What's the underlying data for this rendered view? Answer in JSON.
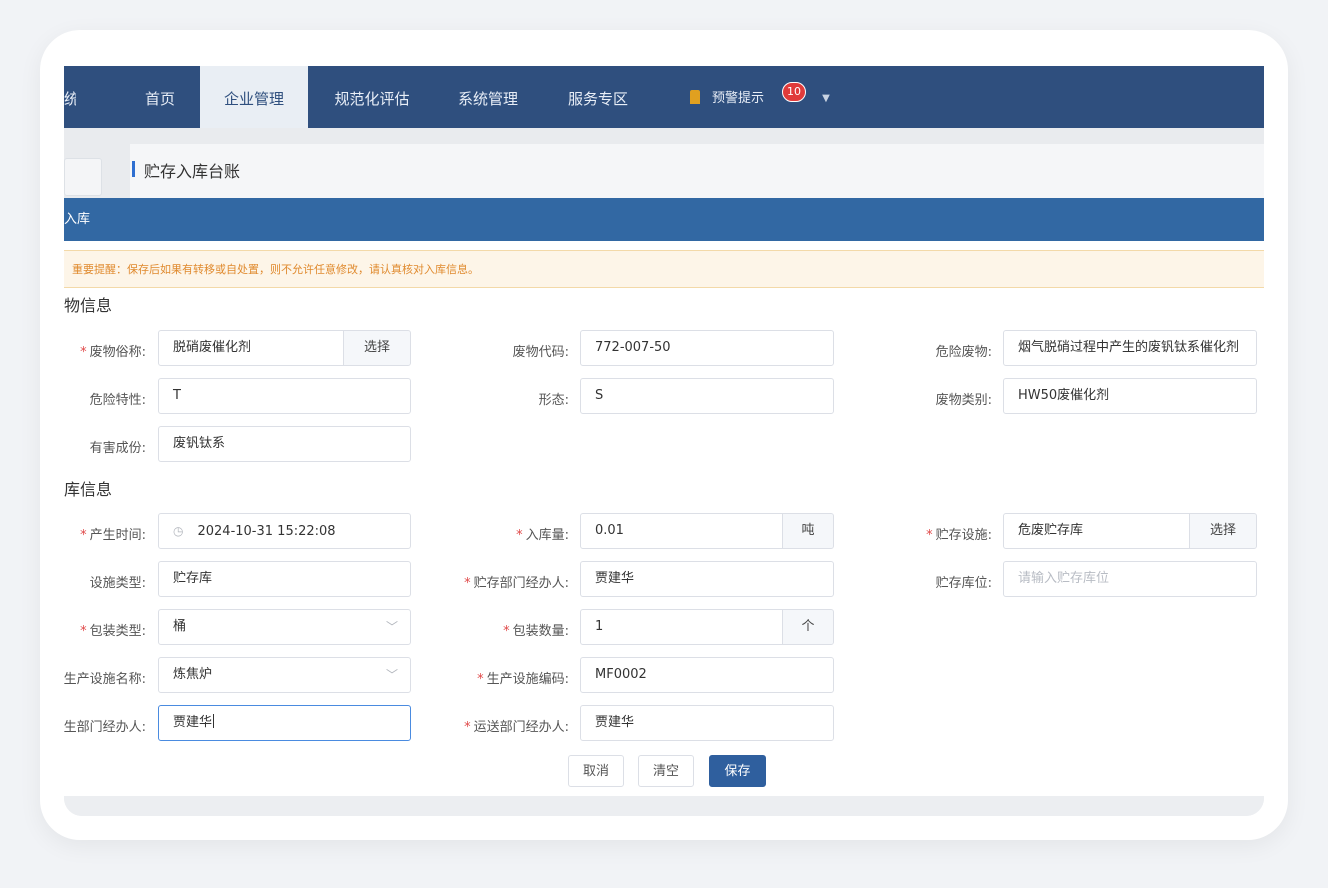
{
  "nav": {
    "partial_title": "统",
    "items": [
      "首页",
      "企业管理",
      "规范化评估",
      "系统管理",
      "服务专区"
    ],
    "active": "企业管理",
    "alert_label": "预警提示",
    "alert_count": "10"
  },
  "background": {
    "page_title": "贮存入库台账"
  },
  "modal": {
    "title": "入库",
    "notice": "重要提醒：保存后如果有转移或自处置，则不允许任意修改，请认真核对入库信息。",
    "section_waste": "物信息",
    "section_storage": "库信息",
    "fields": {
      "waste_name_label": "废物俗称:",
      "waste_name_value": "脱硝废催化剂",
      "waste_name_button": "选择",
      "waste_code_label": "废物代码:",
      "waste_code_value": "772-007-50",
      "hazardous_label": "危险废物:",
      "hazardous_value": "烟气脱硝过程中产生的废钒钛系催化剂",
      "hazard_char_label": "危险特性:",
      "hazard_char_value": "T",
      "form_label": "形态:",
      "form_value": "S",
      "category_label": "废物类别:",
      "category_value": "HW50废催化剂",
      "harmful_label": "有害成份:",
      "harmful_value": "废钒钛系",
      "produce_time_label": "产生时间:",
      "produce_time_value": "2024-10-31 15:22:08",
      "quantity_label": "入库量:",
      "quantity_value": "0.01",
      "quantity_unit": "吨",
      "facility_label": "贮存设施:",
      "facility_value": "危废贮存库",
      "facility_button": "选择",
      "facility_type_label": "设施类型:",
      "facility_type_value": "贮存库",
      "storage_handler_label": "贮存部门经办人:",
      "storage_handler_value": "贾建华",
      "location_label": "贮存库位:",
      "location_placeholder": "请输入贮存库位",
      "package_type_label": "包装类型:",
      "package_type_value": "桶",
      "package_count_label": "包装数量:",
      "package_count_value": "1",
      "package_count_unit": "个",
      "prod_facility_name_label": "生产设施名称:",
      "prod_facility_name_value": "炼焦炉",
      "prod_facility_code_label": "生产设施编码:",
      "prod_facility_code_value": "MF0002",
      "prod_handler_label": "生部门经办人:",
      "prod_handler_value": "贾建华",
      "transport_handler_label": "运送部门经办人:",
      "transport_handler_value": "贾建华"
    },
    "buttons": {
      "cancel": "取消",
      "clear": "清空",
      "save": "保存"
    }
  }
}
